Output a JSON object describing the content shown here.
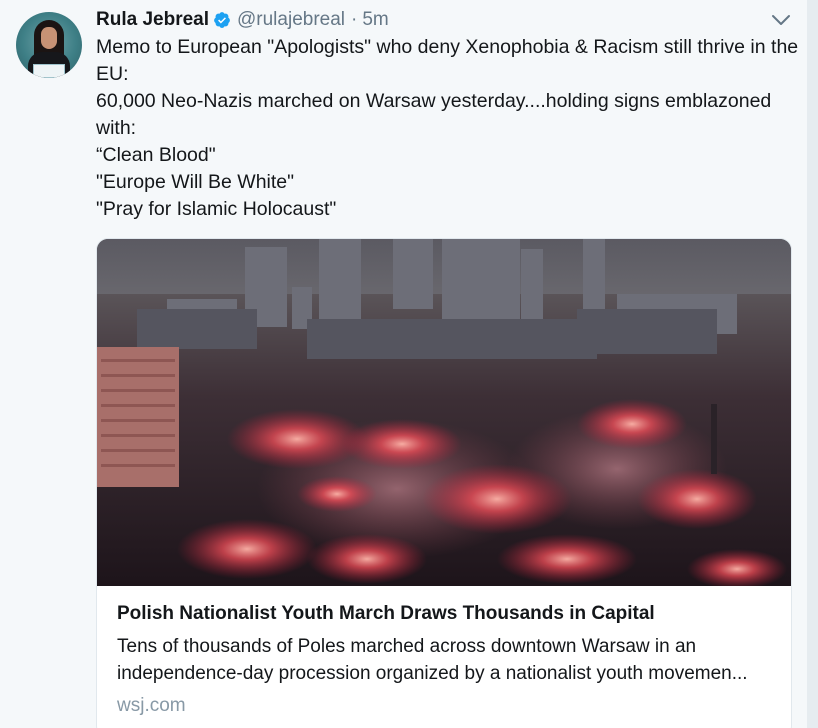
{
  "tweet": {
    "author": {
      "name": "Rula Jebreal",
      "handle": "@rulajebreal",
      "verified": true
    },
    "separator": "·",
    "time": "5m",
    "text_lines": [
      "Memo to European \"Apologists\" who deny Xenophobia & Racism still thrive in the",
      "EU:",
      "60,000 Neo-Nazis marched on Warsaw yesterday....holding signs emblazoned",
      "with:",
      "“Clean Blood\"",
      "\"Europe Will Be White\"",
      "\"Pray for Islamic Holocaust\""
    ],
    "card": {
      "title": "Polish Nationalist Youth March Draws Thousands in Capital",
      "description_lines": [
        "Tens of thousands of Poles marched across downtown Warsaw in an",
        "independence-day procession organized by a nationalist youth movemen..."
      ],
      "domain": "wsj.com"
    }
  },
  "icons": {
    "verified": "verified-badge-icon",
    "caret": "chevron-down-icon"
  },
  "colors": {
    "background": "#f5f8fa",
    "text": "#14171a",
    "secondary": "#657786",
    "verified": "#1da1f2",
    "card_border": "#e1e8ed",
    "domain": "#8899a6"
  }
}
